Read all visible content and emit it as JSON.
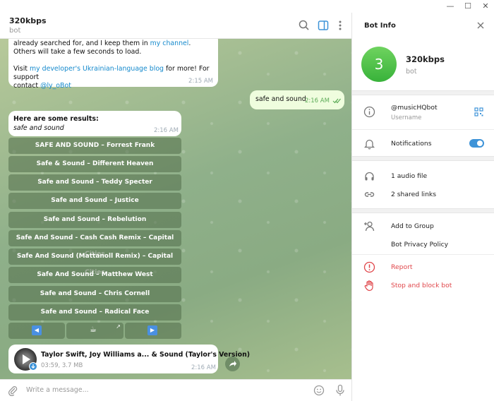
{
  "window": {
    "minimize": "—",
    "maximize": "☐",
    "close": "✕"
  },
  "chat": {
    "title": "320kbps",
    "subtitle": "bot",
    "input_placeholder": "Write a message...",
    "messages": {
      "m1_line1_pre": "already searched for, and I keep them in ",
      "m1_line1_link": "my channel",
      "m1_line1_post": ".",
      "m1_line2": "Others will take a few seconds to load.",
      "m1_line3_pre": "Visit ",
      "m1_line3_link": "my developer's Ukrainian-language blog",
      "m1_line3_post": " for more! For support",
      "m1_line4_pre": "contact ",
      "m1_line4_link": "@ly_oBot",
      "m1_time": "2:15 AM",
      "out_text": "safe and sound",
      "out_time": "2:16 AM",
      "res_title": "Here are some results:",
      "res_query": "safe and sound",
      "res_time": "2:16 AM"
    },
    "results": [
      "SAFE AND SOUND – Forrest Frank",
      "Safe & Sound – Different Heaven",
      "Safe and Sound – Teddy Specter",
      "Safe and Sound – Justice",
      "Safe and Sound – Rebelution",
      "Safe And Sound - Cash Cash Remix – Capital Cities",
      "Safe And Sound (Mattanoll Remix) – Capital Cities",
      "Safe And Sound – Matthew West",
      "Safe and Sound – Chris Cornell",
      "Safe and Sound – Radical Face"
    ],
    "nav": {
      "prev": "◀",
      "middle": "☕",
      "next": "▶",
      "middle_corner": "↗"
    },
    "audio": {
      "title": "Taylor Swift, Joy Williams a...  & Sound (Taylor's Version)",
      "meta": "03:59, 3.7 MB",
      "time": "2:16 AM"
    }
  },
  "panel": {
    "title": "Bot Info",
    "avatar_letter": "3",
    "name": "320kbps",
    "status": "bot",
    "username": "@musicHQbot",
    "username_label": "Username",
    "notifications": "Notifications",
    "notifications_on": true,
    "audio_files": "1 audio file",
    "shared_links": "2 shared links",
    "add_to_group": "Add to Group",
    "privacy_policy": "Bot Privacy Policy",
    "report": "Report",
    "stop_block": "Stop and block bot"
  },
  "colors": {
    "accent": "#168acd",
    "danger": "#e0464a",
    "toggle": "#3d93d8",
    "avatar": "#45bd42"
  }
}
